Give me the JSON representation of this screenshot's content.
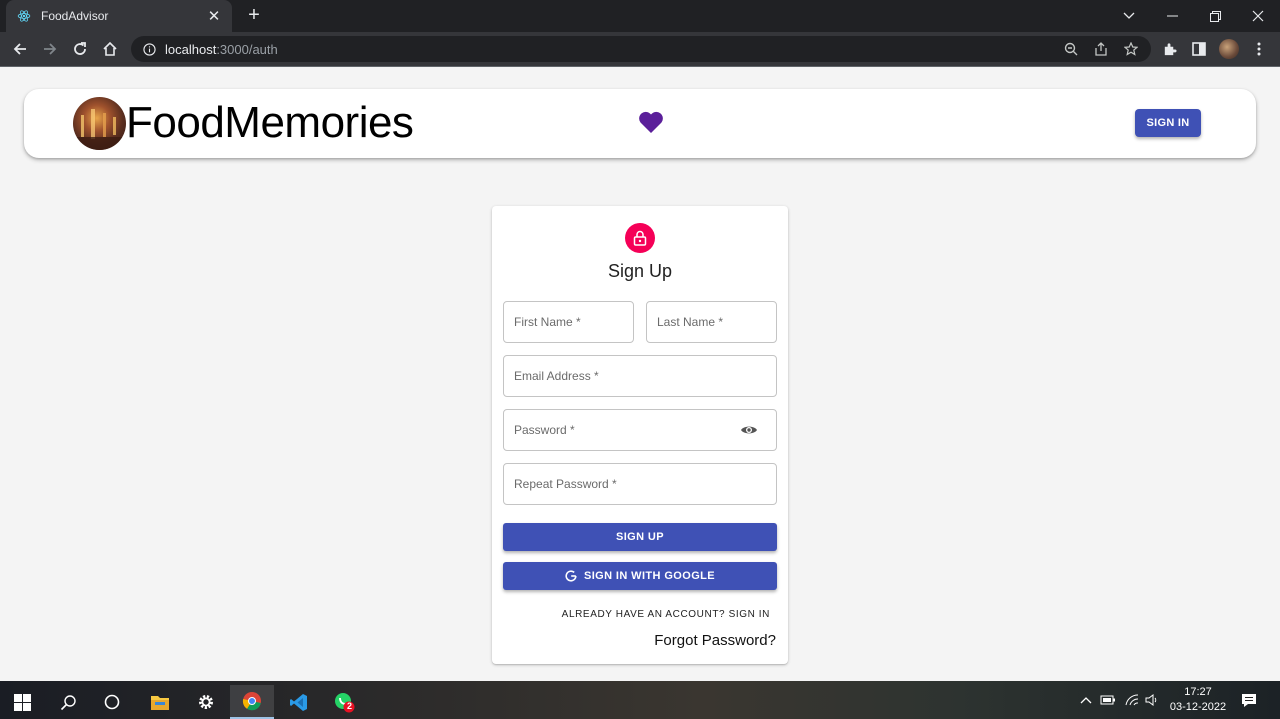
{
  "browser": {
    "tab_title": "FoodAdvisor",
    "url_host": "localhost",
    "url_rest": ":3000/auth"
  },
  "header": {
    "brand": "FoodMemories",
    "signin_label": "SIGN IN"
  },
  "form": {
    "title": "Sign Up",
    "first_name_label": "First Name *",
    "last_name_label": "Last Name *",
    "email_label": "Email Address *",
    "password_label": "Password *",
    "repeat_password_label": "Repeat Password *",
    "signup_label": "SIGN UP",
    "google_label": "SIGN IN WITH GOOGLE",
    "switch_label": "ALREADY HAVE AN ACCOUNT? SIGN IN",
    "forgot_label": "Forgot Password?"
  },
  "taskbar": {
    "time": "17:27",
    "date": "03-12-2022",
    "whatsapp_badge": "2"
  },
  "colors": {
    "primary": "#3f51b5",
    "accent": "#f50057",
    "heart": "#5b1f9a"
  }
}
